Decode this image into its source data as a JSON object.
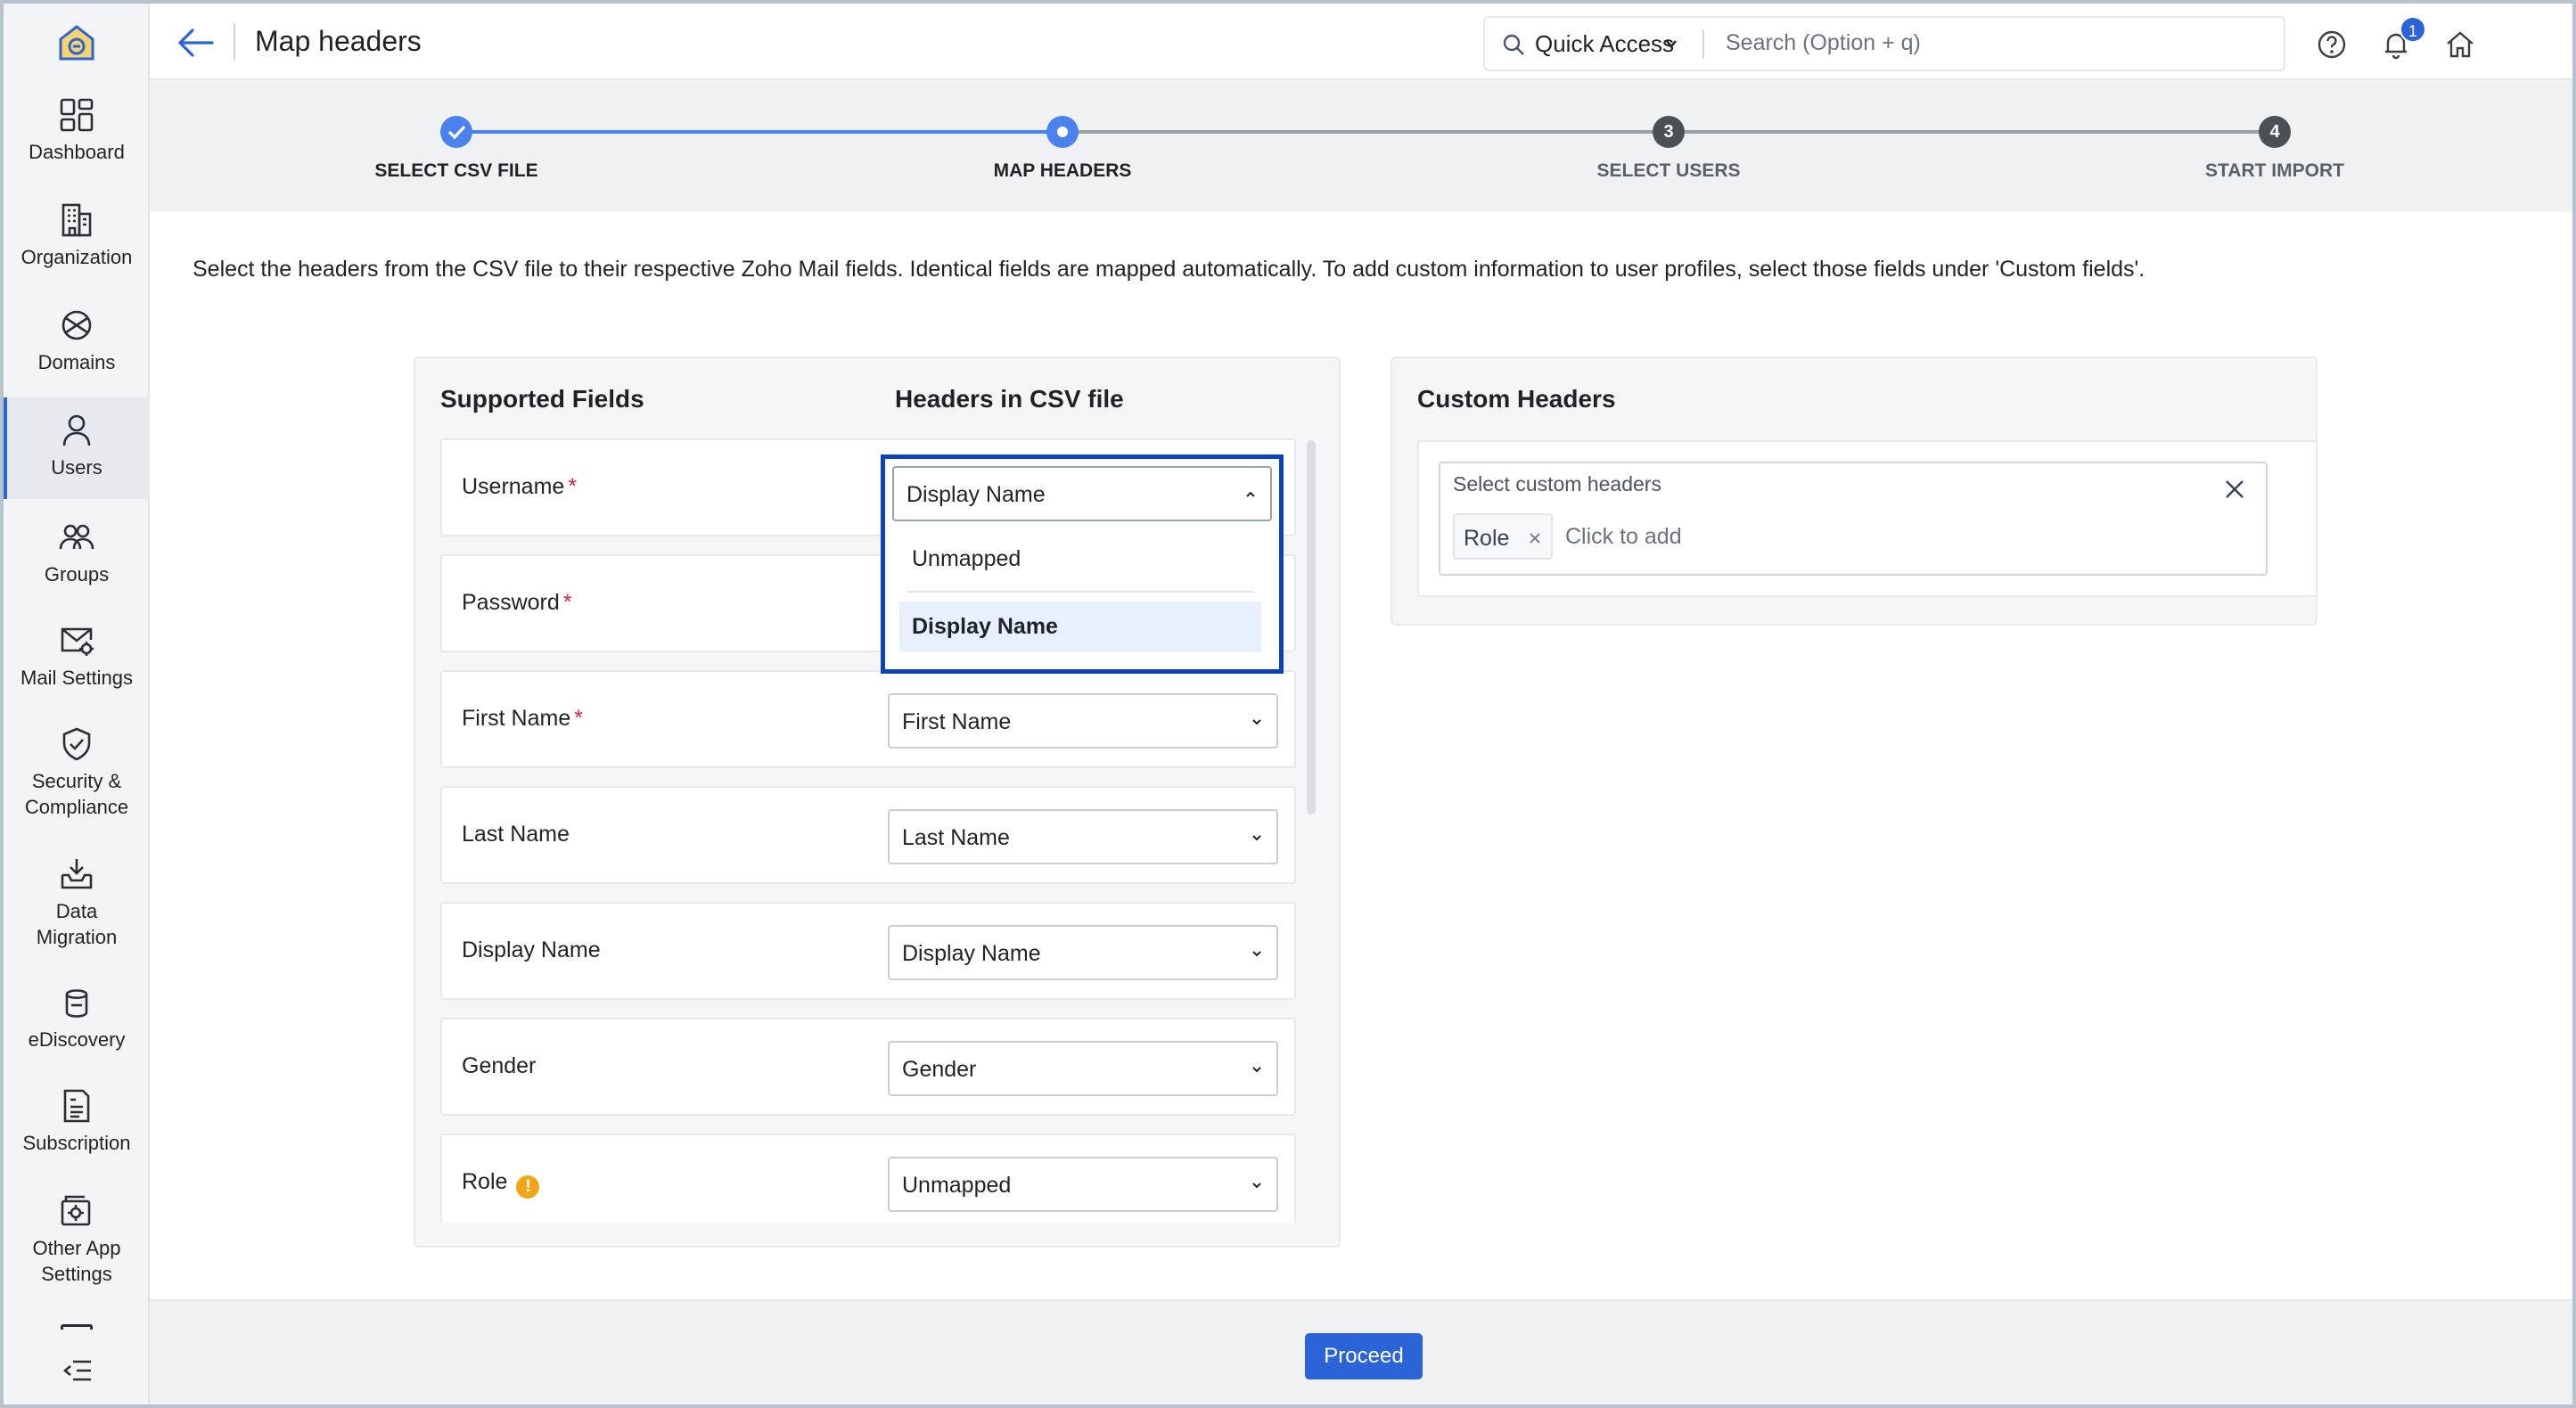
{
  "header": {
    "title": "Map headers",
    "quick_access": "Quick Access",
    "search_placeholder": "Search (Option + q)",
    "notification_count": "1"
  },
  "sidebar": {
    "items": [
      {
        "label": "Dashboard",
        "icon": "dashboard-icon"
      },
      {
        "label": "Organization",
        "icon": "building-icon"
      },
      {
        "label": "Domains",
        "icon": "globe-icon"
      },
      {
        "label": "Users",
        "icon": "user-icon",
        "active": true
      },
      {
        "label": "Groups",
        "icon": "group-icon"
      },
      {
        "label": "Mail Settings",
        "icon": "mail-settings-icon"
      },
      {
        "label": "Security & Compliance",
        "icon": "shield-icon"
      },
      {
        "label": "Data Migration",
        "icon": "download-tray-icon"
      },
      {
        "label": "eDiscovery",
        "icon": "ediscovery-icon"
      },
      {
        "label": "Subscription",
        "icon": "invoice-icon"
      },
      {
        "label": "Other App Settings",
        "icon": "app-settings-icon"
      }
    ]
  },
  "stepper": {
    "steps": [
      {
        "label": "SELECT CSV FILE",
        "state": "done"
      },
      {
        "label": "MAP HEADERS",
        "state": "current"
      },
      {
        "label": "SELECT USERS",
        "state": "pending",
        "number": "3"
      },
      {
        "label": "START IMPORT",
        "state": "pending",
        "number": "4"
      }
    ]
  },
  "description": "Select the headers from the CSV file to their respective Zoho Mail fields. Identical fields are mapped automatically. To add custom information to user profiles, select those fields under 'Custom fields'.",
  "mapping": {
    "col_supported": "Supported Fields",
    "col_headers": "Headers in CSV file",
    "rows": [
      {
        "field": "Username",
        "required": true,
        "value": "Display Name"
      },
      {
        "field": "Password",
        "required": true,
        "value": ""
      },
      {
        "field": "First Name",
        "required": true,
        "value": "First Name"
      },
      {
        "field": "Last Name",
        "required": false,
        "value": "Last Name"
      },
      {
        "field": "Display Name",
        "required": false,
        "value": "Display Name"
      },
      {
        "field": "Gender",
        "required": false,
        "value": "Gender"
      },
      {
        "field": "Role",
        "required": false,
        "warning": "!",
        "value": "Unmapped"
      }
    ],
    "required_marker": "*",
    "dropdown": {
      "selected": "Display Name",
      "options": [
        "Unmapped",
        "Display Name"
      ],
      "highlighted": "Display Name"
    }
  },
  "custom_headers": {
    "title": "Custom Headers",
    "field_label": "Select custom headers",
    "chips": [
      "Role"
    ],
    "placeholder": "Click to add"
  },
  "footer": {
    "proceed_label": "Proceed"
  },
  "colors": {
    "accent": "#2b64d6",
    "highlight_border": "#0b44b8",
    "required": "#e0243a",
    "warning": "#f2a516"
  }
}
